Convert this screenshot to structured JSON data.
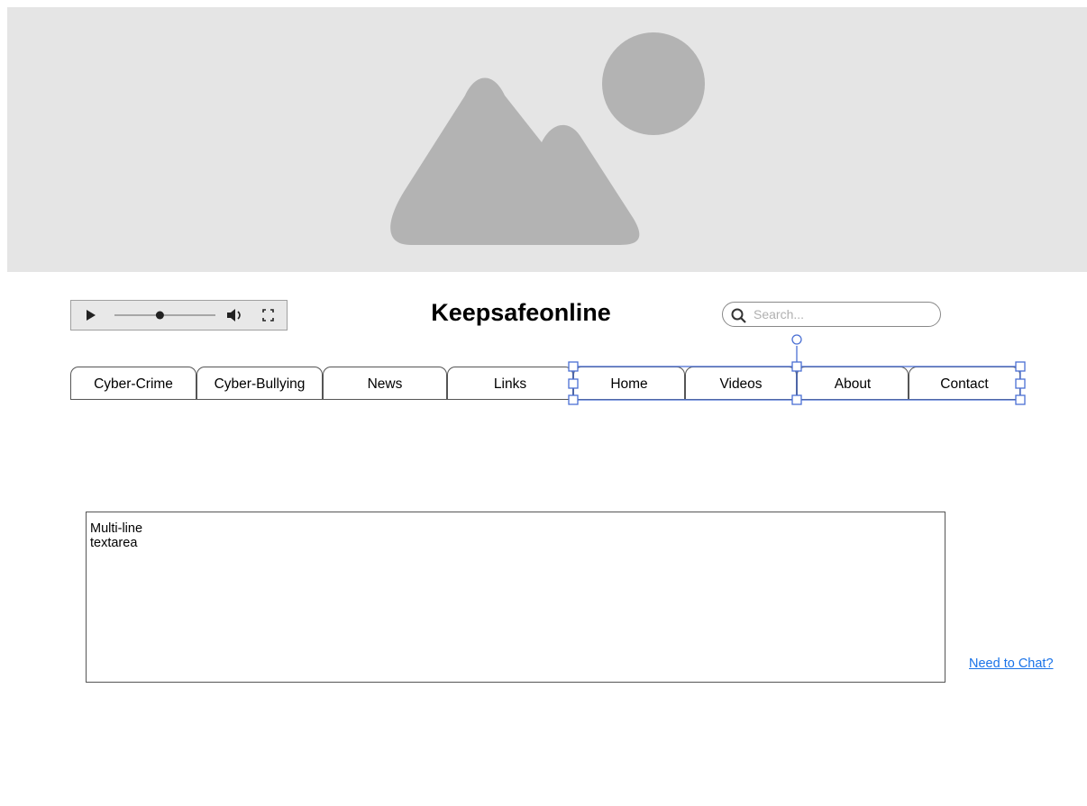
{
  "header": {
    "title": "Keepsafeonline"
  },
  "search": {
    "placeholder": "Search..."
  },
  "nav": {
    "tabs": [
      {
        "label": "Cyber-Crime"
      },
      {
        "label": "Cyber-Bullying"
      },
      {
        "label": "News"
      },
      {
        "label": "Links"
      },
      {
        "label": "Home"
      },
      {
        "label": "Videos"
      },
      {
        "label": "About"
      },
      {
        "label": "Contact"
      }
    ]
  },
  "textarea": {
    "value": "Multi-line\ntextarea"
  },
  "chat": {
    "label": "Need to Chat?"
  },
  "media_player": {
    "progress": 0.45,
    "icons": [
      "play-icon",
      "volume-icon",
      "fullscreen-icon"
    ]
  },
  "colors": {
    "hero_background": "#e5e5e5",
    "hero_graphic": "#b3b3b3",
    "selection": "#4a6fd4",
    "link": "#1a73e8"
  }
}
